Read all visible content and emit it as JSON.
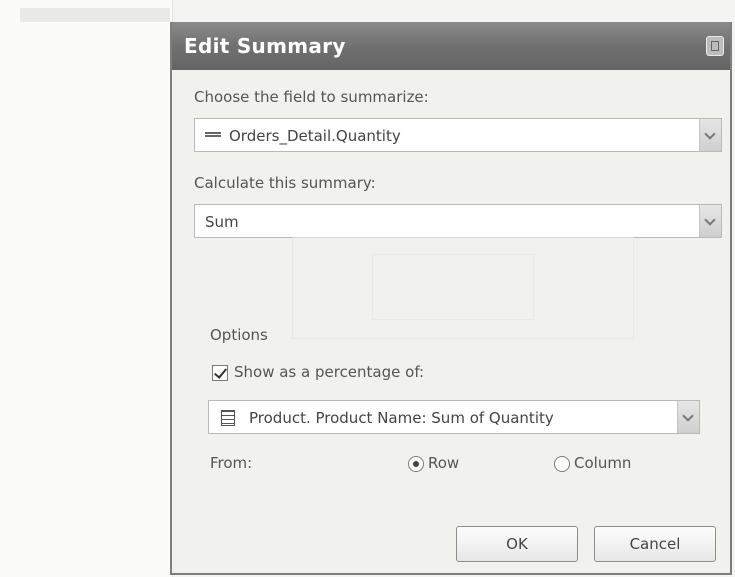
{
  "dialog": {
    "title": "Edit Summary",
    "field_label": "Choose the field to summarize:",
    "field_value": "Orders_Detail.Quantity",
    "calc_label": "Calculate this summary:",
    "calc_value": "Sum",
    "options": {
      "group_label": "Options",
      "show_percentage_label": "Show as a percentage of:",
      "show_percentage_checked": true,
      "percentage_of_value": "Product. Product Name: Sum of Quantity",
      "from_label": "From:",
      "row_label": "Row",
      "column_label": "Column",
      "selected": "Row"
    },
    "buttons": {
      "ok": "OK",
      "cancel": "Cancel"
    },
    "icons": {
      "close": "close-icon",
      "field": "database-field-icon",
      "summary_field": "summary-grid-icon"
    }
  }
}
